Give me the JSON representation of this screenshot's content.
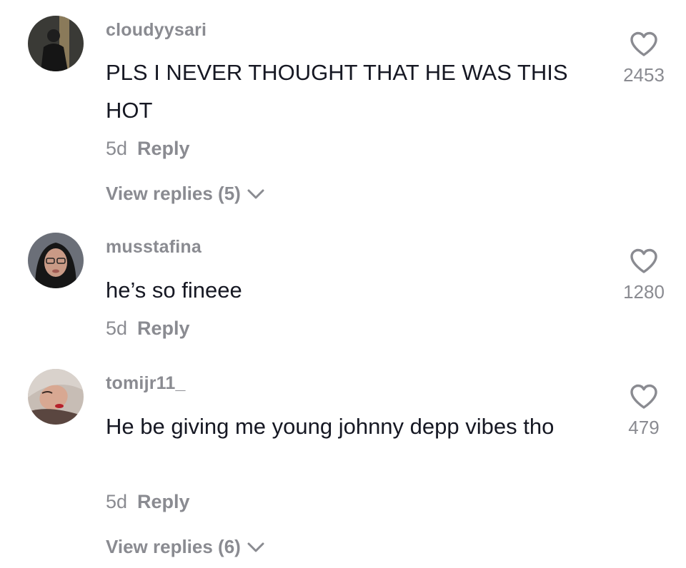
{
  "comments": [
    {
      "username": "cloudyysari",
      "text": "PLS I NEVER THOUGHT THAT HE WAS THIS HOT",
      "time": "5d",
      "reply_label": "Reply",
      "likes": "2453",
      "view_replies": "View replies (5)"
    },
    {
      "username": "musstafina",
      "text": "he’s so fineee",
      "time": "5d",
      "reply_label": "Reply",
      "likes": "1280"
    },
    {
      "username": "tomijr11_",
      "text": "He be giving me young johnny depp vibes tho",
      "time": "5d",
      "reply_label": "Reply",
      "likes": "479",
      "view_replies": "View replies (6)"
    }
  ],
  "icons": {
    "like": "heart-outline-icon",
    "expand": "chevron-down-icon"
  },
  "colors": {
    "primary_text": "#161823",
    "secondary_text": "#8a8b91"
  }
}
